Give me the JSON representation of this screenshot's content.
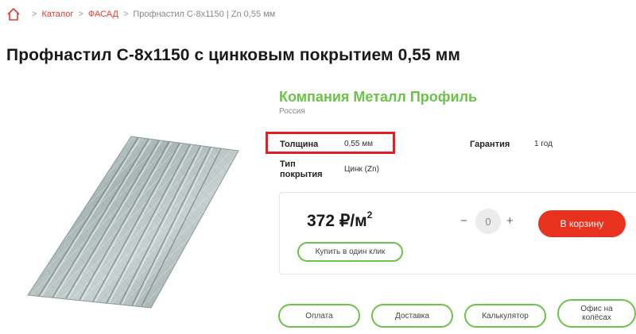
{
  "breadcrumb": {
    "home_icon": "home-icon",
    "separator": ">",
    "items": [
      "Каталог",
      "ФАСАД",
      "Профнастил С-8х1150 | Zn 0,55 мм"
    ]
  },
  "title": "Профнастил С-8х1150 с цинковым покрытием 0,55 мм",
  "company": {
    "name": "Компания Металл Профиль",
    "country": "Россия"
  },
  "attributes": {
    "thickness": {
      "label": "Толщина",
      "value": "0,55 мм"
    },
    "warranty": {
      "label": "Гарантия",
      "value": "1 год"
    },
    "coating": {
      "label_line1": "Тип",
      "label_line2": "покрытия",
      "value": "Цинк (Zn)"
    }
  },
  "price": {
    "value": "372 ₽/м",
    "superscript": "2"
  },
  "quantity": {
    "minus": "−",
    "value": "0",
    "plus": "+"
  },
  "buttons": {
    "cart": "В корзину",
    "one_click": "Купить в один клик",
    "payment": "Оплата",
    "delivery": "Доставка",
    "calculator": "Калькулятор",
    "office_line1": "Офис на",
    "office_line2": "колёсах"
  },
  "colors": {
    "accent_red": "#e8321e",
    "brand_green": "#6cc24a",
    "highlight_red": "#e01e25"
  }
}
